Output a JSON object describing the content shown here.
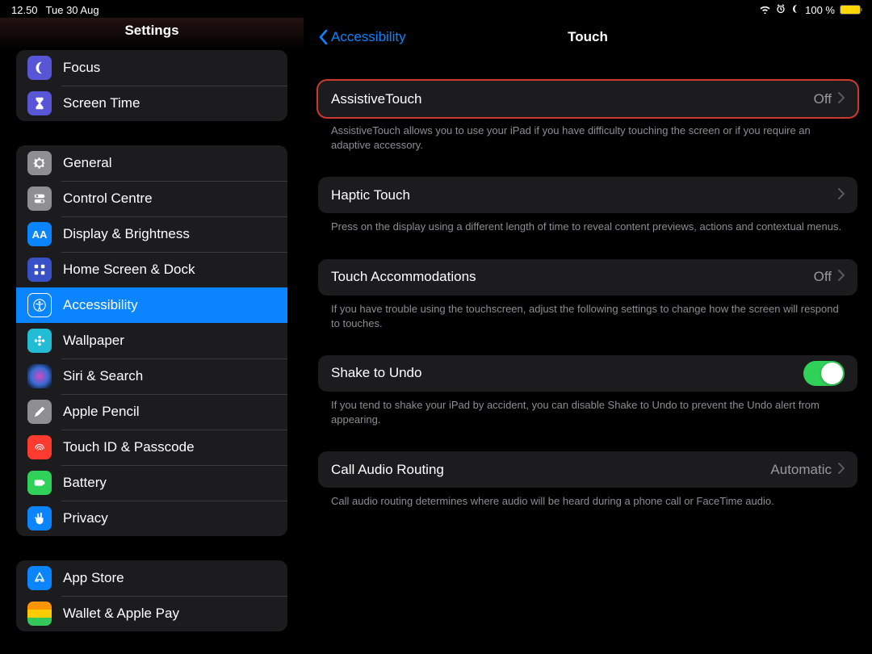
{
  "status": {
    "time": "12.50",
    "date": "Tue 30 Aug",
    "battery": "100 %"
  },
  "sidebar": {
    "title": "Settings",
    "section0": [
      {
        "label": "Focus",
        "icon": "moon-icon",
        "bg": "#5856d6"
      },
      {
        "label": "Screen Time",
        "icon": "hourglass-icon",
        "bg": "#5856d6"
      }
    ],
    "section1": [
      {
        "label": "General",
        "icon": "gear-icon",
        "bg": "#8e8e93"
      },
      {
        "label": "Control Centre",
        "icon": "switches-icon",
        "bg": "#8e8e93"
      },
      {
        "label": "Display & Brightness",
        "icon": "aa-icon",
        "bg": "#0a84ff"
      },
      {
        "label": "Home Screen & Dock",
        "icon": "grid-icon",
        "bg": "#3951c6"
      },
      {
        "label": "Accessibility",
        "icon": "accessibility-icon",
        "bg": "#0a84ff",
        "selected": true
      },
      {
        "label": "Wallpaper",
        "icon": "flower-icon",
        "bg": "#22bcd4"
      },
      {
        "label": "Siri & Search",
        "icon": "siri-icon",
        "bg": "#1c1c1e"
      },
      {
        "label": "Apple Pencil",
        "icon": "pencil-icon",
        "bg": "#8e8e93"
      },
      {
        "label": "Touch ID & Passcode",
        "icon": "fingerprint-icon",
        "bg": "#ff3b30"
      },
      {
        "label": "Battery",
        "icon": "battery-icon",
        "bg": "#30d158"
      },
      {
        "label": "Privacy",
        "icon": "hand-icon",
        "bg": "#0a84ff"
      }
    ],
    "section2": [
      {
        "label": "App Store",
        "icon": "appstore-icon",
        "bg": "#0a84ff"
      },
      {
        "label": "Wallet & Apple Pay",
        "icon": "wallet-icon",
        "bg": "#1c1c1e"
      }
    ]
  },
  "detail": {
    "back": "Accessibility",
    "title": "Touch",
    "assistive": {
      "label": "AssistiveTouch",
      "value": "Off",
      "footer": "AssistiveTouch allows you to use your iPad if you have difficulty touching the screen or if you require an adaptive accessory."
    },
    "haptic": {
      "label": "Haptic Touch",
      "footer": "Press on the display using a different length of time to reveal content previews, actions and contextual menus."
    },
    "accommodations": {
      "label": "Touch Accommodations",
      "value": "Off",
      "footer": "If you have trouble using the touchscreen, adjust the following settings to change how the screen will respond to touches."
    },
    "shake": {
      "label": "Shake to Undo",
      "on": true,
      "footer": "If you tend to shake your iPad by accident, you can disable Shake to Undo to prevent the Undo alert from appearing."
    },
    "callrouting": {
      "label": "Call Audio Routing",
      "value": "Automatic",
      "footer": "Call audio routing determines where audio will be heard during a phone call or FaceTime audio."
    }
  }
}
